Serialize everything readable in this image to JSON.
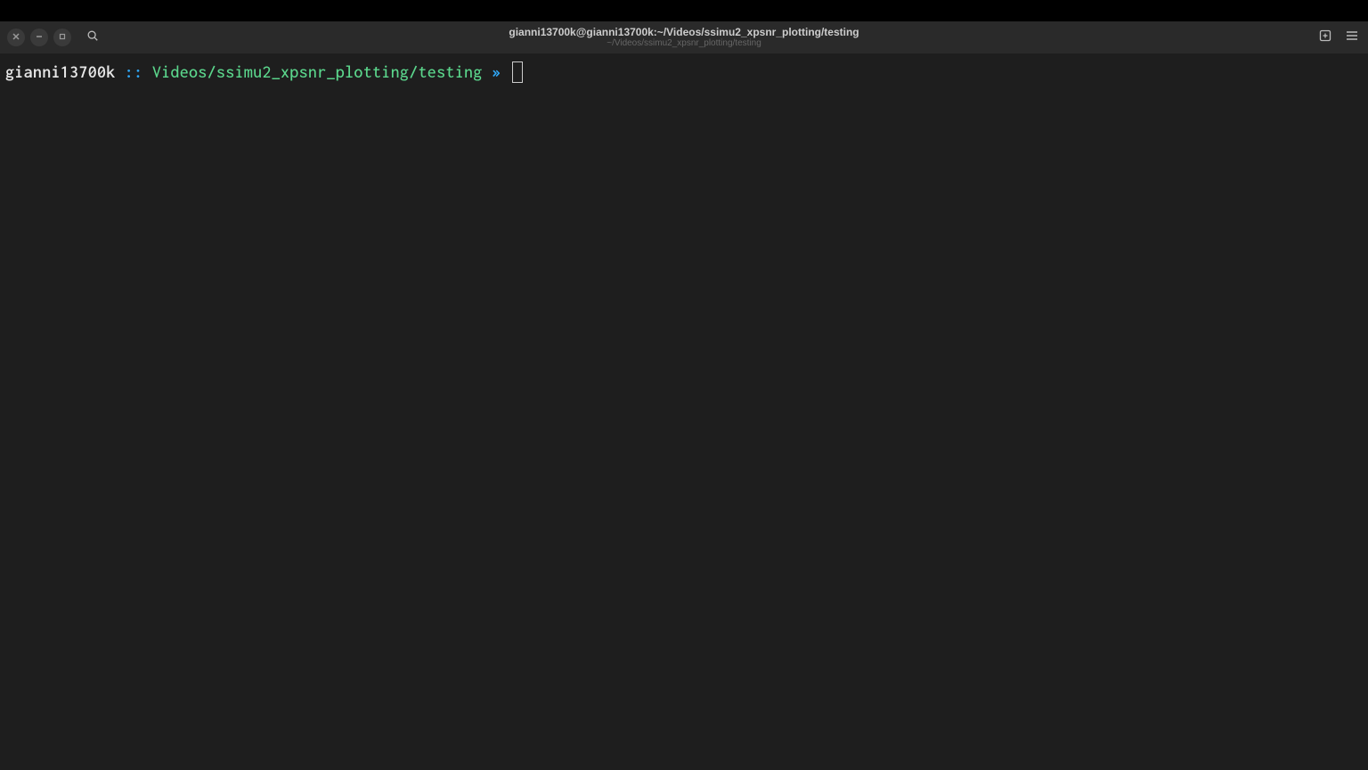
{
  "titlebar": {
    "title_main": "gianni13700k@gianni13700k:~/Videos/ssimu2_xpsnr_plotting/testing",
    "title_sub": "~/Videos/ssimu2_xpsnr_plotting/testing"
  },
  "prompt": {
    "user": "gianni13700k",
    "separator": " :: ",
    "path": "Videos/ssimu2_xpsnr_plotting/testing",
    "arrow": " » "
  },
  "icons": {
    "close": "close-icon",
    "minimize": "minimize-icon",
    "maximize": "maximize-icon",
    "search": "search-icon",
    "new_tab": "new-tab-icon",
    "menu": "menu-icon"
  },
  "colors": {
    "bg_outer": "#000000",
    "bg_titlebar": "#2a2a2a",
    "bg_terminal": "#1e1e1e",
    "prompt_user": "#e8e8e8",
    "prompt_sep": "#2fa8f8",
    "prompt_path": "#5bd68c",
    "prompt_arrow": "#2fa8f8"
  }
}
